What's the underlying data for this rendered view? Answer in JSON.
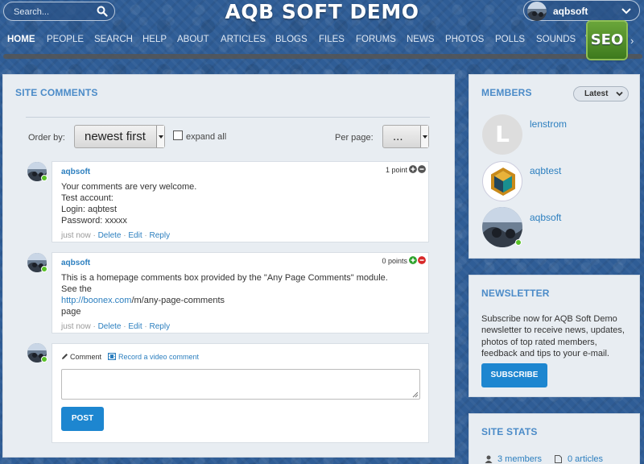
{
  "header": {
    "search_placeholder": "Search...",
    "site_title": "AQB SOFT DEMO",
    "username": "aqbsoft"
  },
  "nav": {
    "items": [
      "HOME",
      "PEOPLE",
      "SEARCH",
      "HELP",
      "ABOUT",
      "ARTICLES",
      "BLOGS",
      "FILES",
      "FORUMS",
      "NEWS",
      "PHOTOS",
      "POLLS",
      "SOUNDS",
      "VI"
    ],
    "active": "HOME",
    "more": "›",
    "seo_badge": "SEO"
  },
  "site_comments": {
    "title": "SITE COMMENTS",
    "order_label": "Order by:",
    "order_value": "newest first",
    "expand_label": "expand all",
    "perpage_label": "Per page:",
    "perpage_value": "...",
    "comments": [
      {
        "author": "aqbsoft",
        "points": "1 point",
        "lines": [
          "Your comments are very welcome.",
          "Test account:",
          "Login: aqbtest",
          "Password: xxxxx"
        ],
        "time": "just now",
        "actions": [
          "Delete",
          "Edit",
          "Reply"
        ]
      },
      {
        "author": "aqbsoft",
        "points": "0 points",
        "line1": "This is a homepage comments box provided by the \"Any Page Comments\" module.",
        "line2": "See the",
        "link_text": "http://boonex.com",
        "link_tail": "/m/any-page-comments",
        "line4": "page",
        "time": "just now",
        "actions": [
          "Delete",
          "Edit",
          "Reply"
        ]
      }
    ],
    "reply_box": {
      "tab_comment": "Comment",
      "tab_video": "Record a video comment",
      "post_label": "POST"
    }
  },
  "members": {
    "title": "MEMBERS",
    "filter_label": "Latest",
    "list": [
      {
        "name": "lenstrom",
        "avatar_letter": "L"
      },
      {
        "name": "aqbtest"
      },
      {
        "name": "aqbsoft"
      }
    ]
  },
  "newsletter": {
    "title": "NEWSLETTER",
    "text": "Subscribe now for AQB Soft Demo newsletter to receive news, updates, photos of top rated members, feedback and tips to your e-mail.",
    "button": "SUBSCRIBE"
  },
  "site_stats": {
    "title": "SITE STATS",
    "members": "3 members",
    "articles": "0 articles"
  }
}
